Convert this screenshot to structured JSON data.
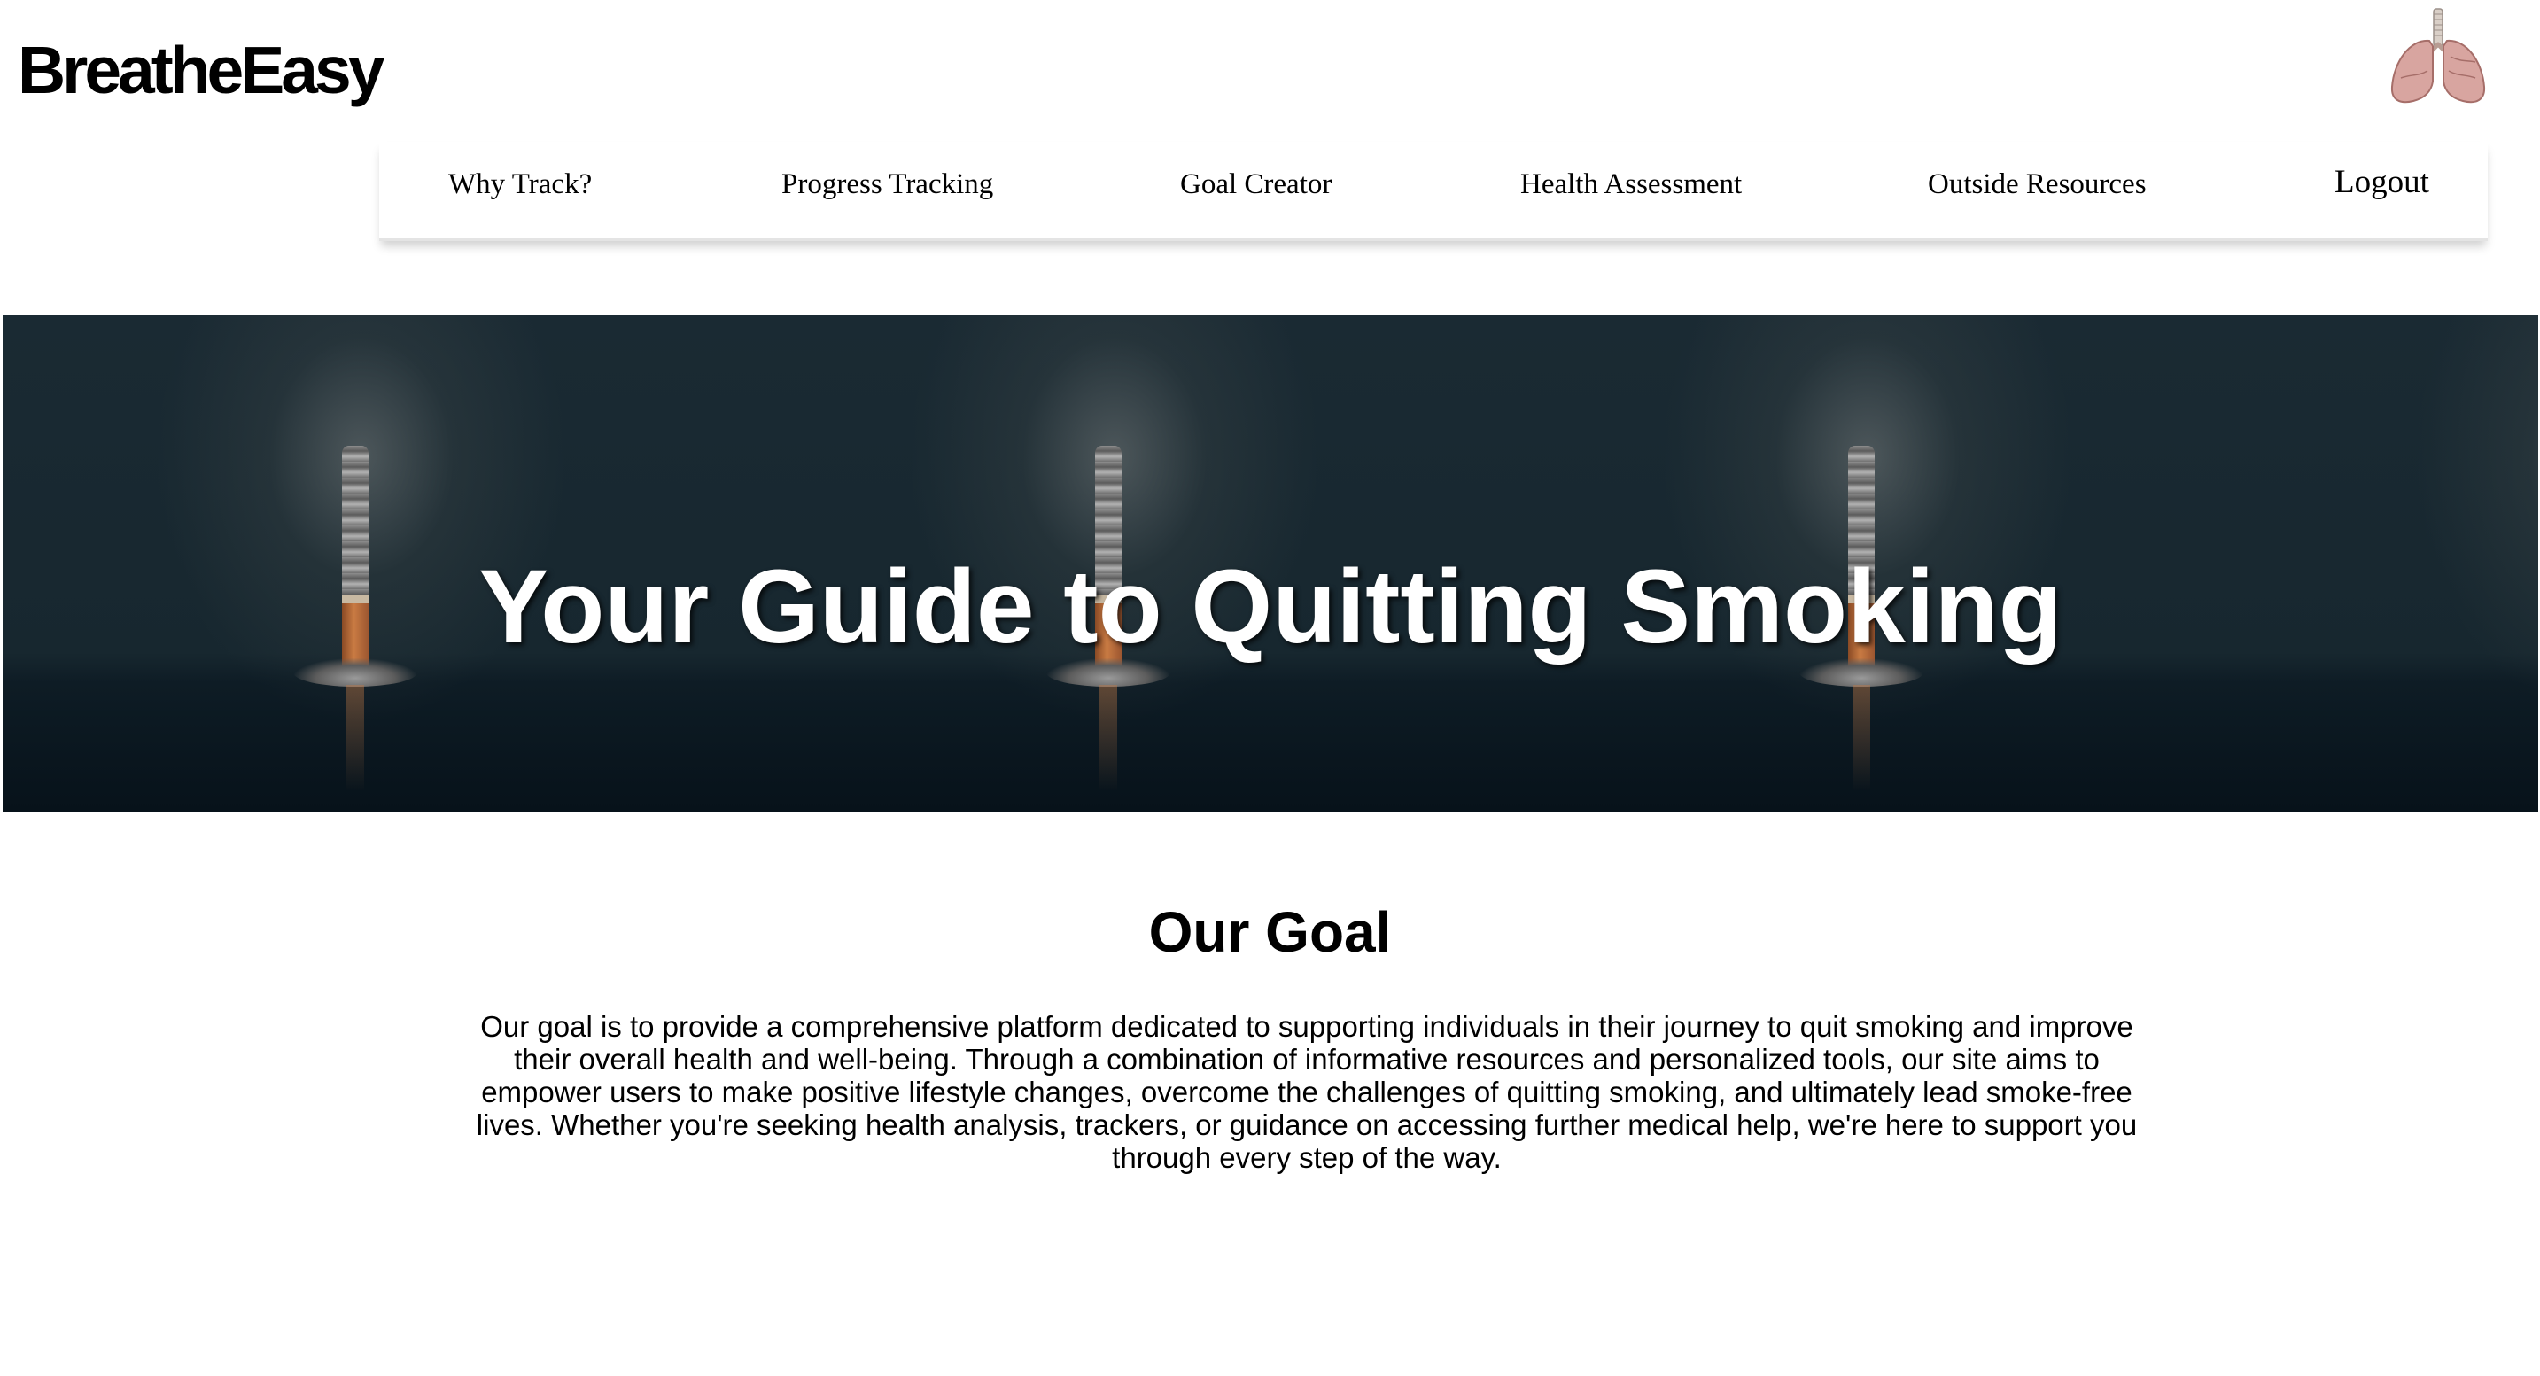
{
  "header": {
    "brand": "BreatheEasy",
    "logo_icon": "lungs-icon"
  },
  "nav": {
    "items": [
      {
        "label": "Why Track?"
      },
      {
        "label": "Progress Tracking"
      },
      {
        "label": "Goal Creator"
      },
      {
        "label": "Health Assessment"
      },
      {
        "label": "Outside Resources"
      },
      {
        "label": "Logout"
      }
    ]
  },
  "hero": {
    "title": "Your Guide to Quitting Smoking",
    "image": "cigarette-image"
  },
  "goal": {
    "title": "Our Goal",
    "text": "Our goal is to provide a comprehensive platform dedicated to supporting individuals in their journey to quit smoking and improve their overall health and well-being. Through a combination of informative resources and personalized tools, our site aims to empower users to make positive lifestyle changes, overcome the challenges of quitting smoking, and ultimately lead smoke-free lives. Whether you're seeking health analysis, trackers, or guidance on accessing further medical help, we're here to support you through every step of the way."
  },
  "colors": {
    "hero_bg": "#0d1a22",
    "text": "#000000",
    "hero_text": "#ffffff"
  }
}
